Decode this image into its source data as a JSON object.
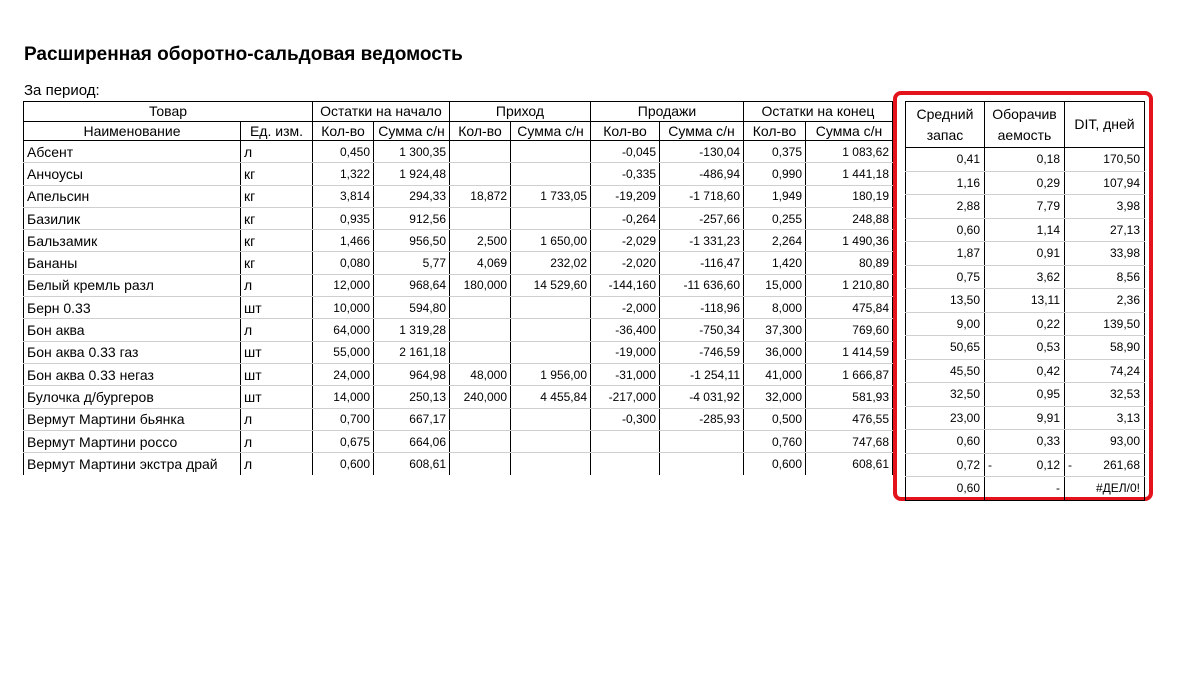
{
  "title": "Расширенная оборотно-сальдовая ведомость",
  "period_label": "За период:",
  "header": {
    "product": "Товар",
    "opening": "Остатки на начало",
    "income": "Приход",
    "sales": "Продажи",
    "closing": "Остатки на конец",
    "name": "Наименование",
    "unit": "Ед. изм.",
    "qty": "Кол-во",
    "sum": "Сумма с/н"
  },
  "rows": [
    {
      "name": "Абсент",
      "unit": "л",
      "op_q": "0,450",
      "op_s": "1 300,35",
      "in_q": "",
      "in_s": "",
      "sa_q": "-0,045",
      "sa_s": "-130,04",
      "cl_q": "0,375",
      "cl_s": "1 083,62"
    },
    {
      "name": "Анчоусы",
      "unit": "кг",
      "op_q": "1,322",
      "op_s": "1 924,48",
      "in_q": "",
      "in_s": "",
      "sa_q": "-0,335",
      "sa_s": "-486,94",
      "cl_q": "0,990",
      "cl_s": "1 441,18"
    },
    {
      "name": "Апельсин",
      "unit": "кг",
      "op_q": "3,814",
      "op_s": "294,33",
      "in_q": "18,872",
      "in_s": "1 733,05",
      "sa_q": "-19,209",
      "sa_s": "-1 718,60",
      "cl_q": "1,949",
      "cl_s": "180,19"
    },
    {
      "name": "Базилик",
      "unit": "кг",
      "op_q": "0,935",
      "op_s": "912,56",
      "in_q": "",
      "in_s": "",
      "sa_q": "-0,264",
      "sa_s": "-257,66",
      "cl_q": "0,255",
      "cl_s": "248,88"
    },
    {
      "name": "Бальзамик",
      "unit": "кг",
      "op_q": "1,466",
      "op_s": "956,50",
      "in_q": "2,500",
      "in_s": "1 650,00",
      "sa_q": "-2,029",
      "sa_s": "-1 331,23",
      "cl_q": "2,264",
      "cl_s": "1 490,36"
    },
    {
      "name": "Бананы",
      "unit": "кг",
      "op_q": "0,080",
      "op_s": "5,77",
      "in_q": "4,069",
      "in_s": "232,02",
      "sa_q": "-2,020",
      "sa_s": "-116,47",
      "cl_q": "1,420",
      "cl_s": "80,89"
    },
    {
      "name": "Белый кремль разл",
      "unit": "л",
      "op_q": "12,000",
      "op_s": "968,64",
      "in_q": "180,000",
      "in_s": "14 529,60",
      "sa_q": "-144,160",
      "sa_s": "-11 636,60",
      "cl_q": "15,000",
      "cl_s": "1 210,80"
    },
    {
      "name": "Берн 0.33",
      "unit": "шт",
      "op_q": "10,000",
      "op_s": "594,80",
      "in_q": "",
      "in_s": "",
      "sa_q": "-2,000",
      "sa_s": "-118,96",
      "cl_q": "8,000",
      "cl_s": "475,84"
    },
    {
      "name": "Бон аква",
      "unit": "л",
      "op_q": "64,000",
      "op_s": "1 319,28",
      "in_q": "",
      "in_s": "",
      "sa_q": "-36,400",
      "sa_s": "-750,34",
      "cl_q": "37,300",
      "cl_s": "769,60"
    },
    {
      "name": "Бон аква 0.33 газ",
      "unit": "шт",
      "op_q": "55,000",
      "op_s": "2 161,18",
      "in_q": "",
      "in_s": "",
      "sa_q": "-19,000",
      "sa_s": "-746,59",
      "cl_q": "36,000",
      "cl_s": "1 414,59"
    },
    {
      "name": "Бон аква 0.33 негаз",
      "unit": "шт",
      "op_q": "24,000",
      "op_s": "964,98",
      "in_q": "48,000",
      "in_s": "1 956,00",
      "sa_q": "-31,000",
      "sa_s": "-1 254,11",
      "cl_q": "41,000",
      "cl_s": "1 666,87"
    },
    {
      "name": "Булочка д/бургеров",
      "unit": "шт",
      "op_q": "14,000",
      "op_s": "250,13",
      "in_q": "240,000",
      "in_s": "4 455,84",
      "sa_q": "-217,000",
      "sa_s": "-4 031,92",
      "cl_q": "32,000",
      "cl_s": "581,93"
    },
    {
      "name": "Вермут Мартини бьянка",
      "unit": "л",
      "op_q": "0,700",
      "op_s": "667,17",
      "in_q": "",
      "in_s": "",
      "sa_q": "-0,300",
      "sa_s": "-285,93",
      "cl_q": "0,500",
      "cl_s": "476,55"
    },
    {
      "name": "Вермут Мартини россо",
      "unit": "л",
      "op_q": "0,675",
      "op_s": "664,06",
      "in_q": "",
      "in_s": "",
      "sa_q": "",
      "sa_s": "",
      "cl_q": "0,760",
      "cl_s": "747,68"
    },
    {
      "name": "Вермут Мартини экстра драй",
      "unit": "л",
      "op_q": "0,600",
      "op_s": "608,61",
      "in_q": "",
      "in_s": "",
      "sa_q": "",
      "sa_s": "",
      "cl_q": "0,600",
      "cl_s": "608,61"
    }
  ],
  "side": {
    "h_avg_1": "Средний",
    "h_avg_2": "запас",
    "h_turn_1": "Оборачив",
    "h_turn_2": "аемость",
    "h_dit": "DIT, дней",
    "rows": [
      {
        "avg": "0,41",
        "turn": "0,18",
        "dit": "170,50",
        "turn_lead": "",
        "dit_lead": ""
      },
      {
        "avg": "1,16",
        "turn": "0,29",
        "dit": "107,94",
        "turn_lead": "",
        "dit_lead": ""
      },
      {
        "avg": "2,88",
        "turn": "7,79",
        "dit": "3,98",
        "turn_lead": "",
        "dit_lead": ""
      },
      {
        "avg": "0,60",
        "turn": "1,14",
        "dit": "27,13",
        "turn_lead": "",
        "dit_lead": ""
      },
      {
        "avg": "1,87",
        "turn": "0,91",
        "dit": "33,98",
        "turn_lead": "",
        "dit_lead": ""
      },
      {
        "avg": "0,75",
        "turn": "3,62",
        "dit": "8,56",
        "turn_lead": "",
        "dit_lead": ""
      },
      {
        "avg": "13,50",
        "turn": "13,11",
        "dit": "2,36",
        "turn_lead": "",
        "dit_lead": ""
      },
      {
        "avg": "9,00",
        "turn": "0,22",
        "dit": "139,50",
        "turn_lead": "",
        "dit_lead": ""
      },
      {
        "avg": "50,65",
        "turn": "0,53",
        "dit": "58,90",
        "turn_lead": "",
        "dit_lead": ""
      },
      {
        "avg": "45,50",
        "turn": "0,42",
        "dit": "74,24",
        "turn_lead": "",
        "dit_lead": ""
      },
      {
        "avg": "32,50",
        "turn": "0,95",
        "dit": "32,53",
        "turn_lead": "",
        "dit_lead": ""
      },
      {
        "avg": "23,00",
        "turn": "9,91",
        "dit": "3,13",
        "turn_lead": "",
        "dit_lead": ""
      },
      {
        "avg": "0,60",
        "turn": "0,33",
        "dit": "93,00",
        "turn_lead": "",
        "dit_lead": ""
      },
      {
        "avg": "0,72",
        "turn": "0,12",
        "dit": "261,68",
        "turn_lead": "-",
        "dit_lead": "-"
      },
      {
        "avg": "0,60",
        "turn": "-",
        "dit": "#ДЕЛ/0!",
        "turn_lead": "",
        "dit_lead": ""
      }
    ]
  },
  "colors": {
    "highlight_border": "#e3121b"
  }
}
